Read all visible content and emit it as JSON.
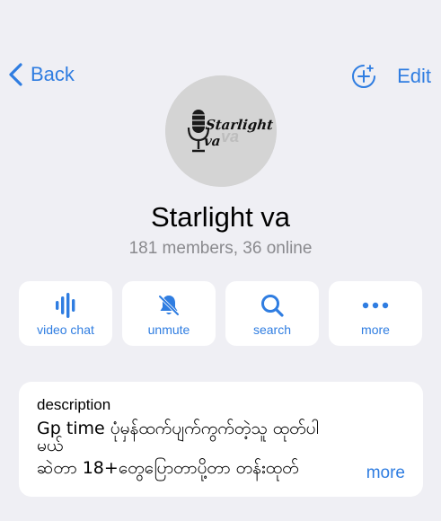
{
  "nav": {
    "back_label": "Back",
    "add_icon": "add-circle-icon",
    "edit_label": "Edit"
  },
  "group": {
    "avatar_text": "Starlight va",
    "name": "Starlight va",
    "stats": "181 members, 36 online"
  },
  "actions": [
    {
      "icon": "waveform-icon",
      "label": "video chat"
    },
    {
      "icon": "bell-slash-icon",
      "label": "unmute"
    },
    {
      "icon": "search-icon",
      "label": "search"
    },
    {
      "icon": "ellipsis-icon",
      "label": "more"
    }
  ],
  "description": {
    "label": "description",
    "line1": "Gp time ပုံမှန်ထက်ပျက်ကွက်တဲ့သူ ထုတ်ပါ",
    "line2": "မယ်",
    "line3": "ဆဲတာ 18+တွေပြောတာပို့တာ တန်းထုတ်",
    "more_label": "more"
  },
  "colors": {
    "accent": "#2f7de1",
    "background": "#efeff4",
    "card": "#ffffff",
    "secondary_text": "#8a8a8e"
  }
}
